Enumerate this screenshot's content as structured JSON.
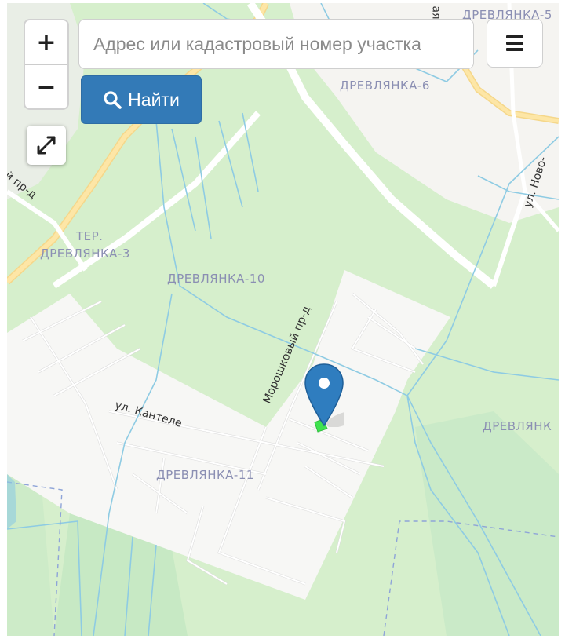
{
  "controls": {
    "zoom_in": "+",
    "zoom_out": "−"
  },
  "search": {
    "placeholder": "Адрес или кадастровый номер участка",
    "value": "",
    "button_label": "Найти"
  },
  "map": {
    "places": [
      {
        "id": "drevlyanka-5",
        "text": "ДРЕВЛЯНКА-5"
      },
      {
        "id": "drevlyanka-6",
        "text": "ДРЕВЛЯНКА-6"
      },
      {
        "id": "ter-line1",
        "text": "ТЕР."
      },
      {
        "id": "ter-line2",
        "text": "ДРЕВЛЯНКА-3"
      },
      {
        "id": "drevlyanka-10",
        "text": "ДРЕВЛЯНКА-10"
      },
      {
        "id": "drevlyanka-11",
        "text": "ДРЕВЛЯНКА-11"
      },
      {
        "id": "drevlyanka-right",
        "text": "ДРЕВЛЯНК"
      }
    ],
    "streets": [
      {
        "id": "proezd-left",
        "text": "й пр-д"
      },
      {
        "id": "moroshkovy",
        "text": "Морошковый пр-д"
      },
      {
        "id": "kantele",
        "text": "ул. Кантеле"
      },
      {
        "id": "novo",
        "text": "ул. Ново-"
      },
      {
        "id": "top-fragment",
        "text": "ая"
      }
    ],
    "colors": {
      "land": "#d6efcc",
      "residential": "#f7f7f5",
      "road": "#ffffff",
      "major_road": "#fde293",
      "water": "#8ecbe3",
      "marker": "#2f7dbf",
      "parcel": "#3fe24e"
    }
  }
}
